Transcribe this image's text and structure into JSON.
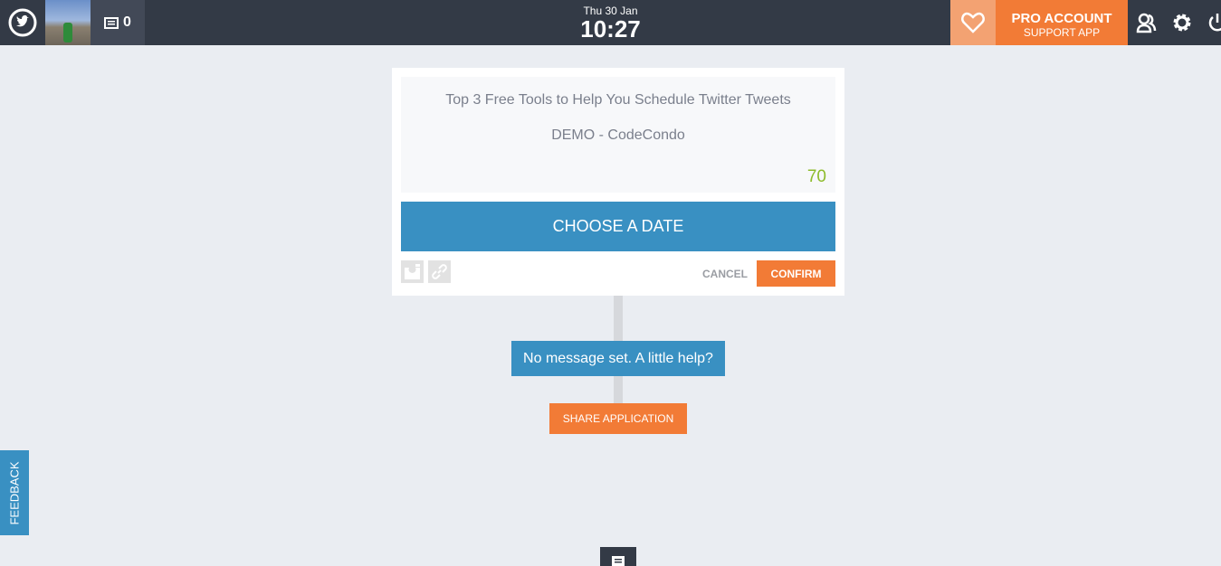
{
  "header": {
    "message_count": "0",
    "date": "Thu 30 Jan",
    "time": "10:27",
    "pro_title": "PRO ACCOUNT",
    "pro_subtitle": "SUPPORT APP"
  },
  "composer": {
    "title": "Top 3 Free Tools to Help You Schedule Twitter Tweets",
    "source": "DEMO - CodeCondo",
    "char_count": "70",
    "choose_date": "CHOOSE A DATE",
    "cancel": "CANCEL",
    "confirm": "CONFIRM"
  },
  "help_message": "No message set. A little help?",
  "share_label": "SHARE APPLICATION",
  "feedback_label": "FEEDBACK",
  "colors": {
    "accent_blue": "#3990c2",
    "accent_orange": "#f27b36",
    "topbar": "#333a46",
    "count_green": "#8dbb2b"
  }
}
